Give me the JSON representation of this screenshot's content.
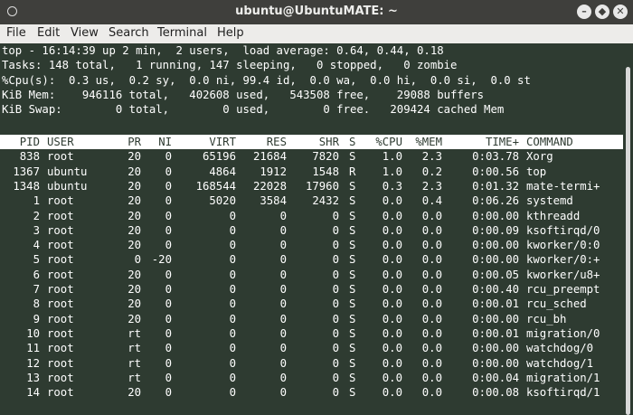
{
  "window": {
    "title": "ubuntu@UbuntuMATE: ~"
  },
  "icons": {
    "app": "terminal-circle-icon",
    "minimize": "minimize-icon",
    "maximize": "maximize-icon",
    "close": "close-icon"
  },
  "menu": [
    "File",
    "Edit",
    "View",
    "Search",
    "Terminal",
    "Help"
  ],
  "summary": [
    "top - 16:14:39 up 2 min,  2 users,  load average: 0.64, 0.44, 0.18",
    "Tasks: 148 total,   1 running, 147 sleeping,   0 stopped,   0 zombie",
    "%Cpu(s):  0.3 us,  0.2 sy,  0.0 ni, 99.4 id,  0.0 wa,  0.0 hi,  0.0 si,  0.0 st",
    "KiB Mem:    946116 total,   402608 used,   543508 free,    29088 buffers",
    "KiB Swap:        0 total,        0 used,        0 free.   209424 cached Mem"
  ],
  "columns": [
    "PID",
    "USER",
    "PR",
    "NI",
    "VIRT",
    "RES",
    "SHR",
    "S",
    "%CPU",
    "%MEM",
    "TIME+",
    "COMMAND"
  ],
  "processes": [
    [
      "838",
      "root",
      "20",
      "0",
      "65196",
      "21684",
      "7820",
      "S",
      "1.0",
      "2.3",
      "0:03.78",
      "Xorg"
    ],
    [
      "1367",
      "ubuntu",
      "20",
      "0",
      "4864",
      "1912",
      "1548",
      "R",
      "1.0",
      "0.2",
      "0:00.56",
      "top"
    ],
    [
      "1348",
      "ubuntu",
      "20",
      "0",
      "168544",
      "22028",
      "17960",
      "S",
      "0.3",
      "2.3",
      "0:01.32",
      "mate-termi+"
    ],
    [
      "1",
      "root",
      "20",
      "0",
      "5020",
      "3584",
      "2432",
      "S",
      "0.0",
      "0.4",
      "0:06.26",
      "systemd"
    ],
    [
      "2",
      "root",
      "20",
      "0",
      "0",
      "0",
      "0",
      "S",
      "0.0",
      "0.0",
      "0:00.00",
      "kthreadd"
    ],
    [
      "3",
      "root",
      "20",
      "0",
      "0",
      "0",
      "0",
      "S",
      "0.0",
      "0.0",
      "0:00.09",
      "ksoftirqd/0"
    ],
    [
      "4",
      "root",
      "20",
      "0",
      "0",
      "0",
      "0",
      "S",
      "0.0",
      "0.0",
      "0:00.00",
      "kworker/0:0"
    ],
    [
      "5",
      "root",
      "0",
      "-20",
      "0",
      "0",
      "0",
      "S",
      "0.0",
      "0.0",
      "0:00.00",
      "kworker/0:+"
    ],
    [
      "6",
      "root",
      "20",
      "0",
      "0",
      "0",
      "0",
      "S",
      "0.0",
      "0.0",
      "0:00.05",
      "kworker/u8+"
    ],
    [
      "7",
      "root",
      "20",
      "0",
      "0",
      "0",
      "0",
      "S",
      "0.0",
      "0.0",
      "0:00.40",
      "rcu_preempt"
    ],
    [
      "8",
      "root",
      "20",
      "0",
      "0",
      "0",
      "0",
      "S",
      "0.0",
      "0.0",
      "0:00.01",
      "rcu_sched"
    ],
    [
      "9",
      "root",
      "20",
      "0",
      "0",
      "0",
      "0",
      "S",
      "0.0",
      "0.0",
      "0:00.00",
      "rcu_bh"
    ],
    [
      "10",
      "root",
      "rt",
      "0",
      "0",
      "0",
      "0",
      "S",
      "0.0",
      "0.0",
      "0:00.01",
      "migration/0"
    ],
    [
      "11",
      "root",
      "rt",
      "0",
      "0",
      "0",
      "0",
      "S",
      "0.0",
      "0.0",
      "0:00.00",
      "watchdog/0"
    ],
    [
      "12",
      "root",
      "rt",
      "0",
      "0",
      "0",
      "0",
      "S",
      "0.0",
      "0.0",
      "0:00.00",
      "watchdog/1"
    ],
    [
      "13",
      "root",
      "rt",
      "0",
      "0",
      "0",
      "0",
      "S",
      "0.0",
      "0.0",
      "0:00.04",
      "migration/1"
    ],
    [
      "14",
      "root",
      "20",
      "0",
      "0",
      "0",
      "0",
      "S",
      "0.0",
      "0.0",
      "0:00.08",
      "ksoftirqd/1"
    ]
  ]
}
